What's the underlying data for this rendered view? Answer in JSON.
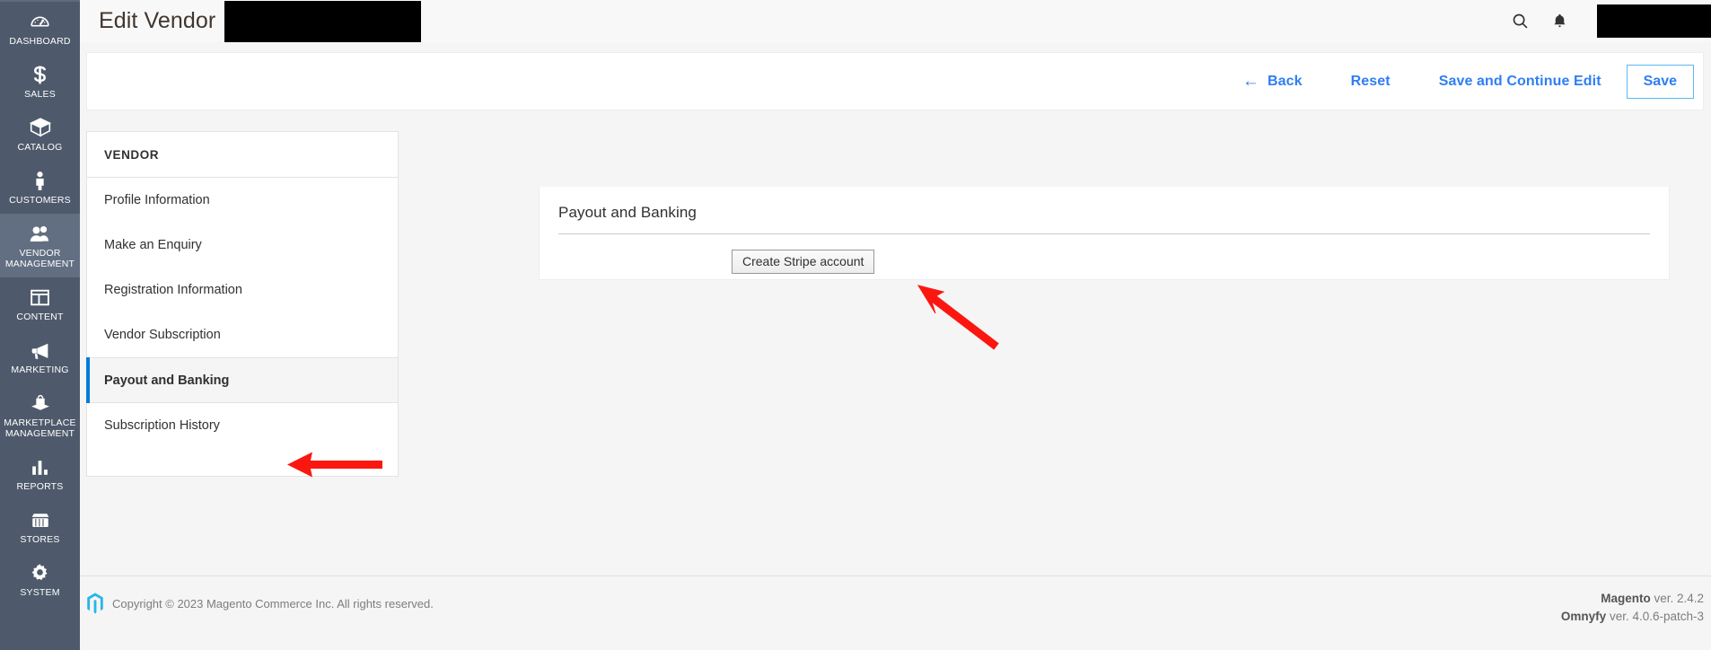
{
  "admin_rail": {
    "items": [
      {
        "label": "DASHBOARD",
        "icon": "dashboard-gauge-icon",
        "active": false
      },
      {
        "label": "SALES",
        "icon": "dollar-sign-icon",
        "active": false
      },
      {
        "label": "CATALOG",
        "icon": "box-icon",
        "active": false
      },
      {
        "label": "CUSTOMERS",
        "icon": "person-icon",
        "active": false
      },
      {
        "label": "VENDOR MANAGEMENT",
        "icon": "two-people-icon",
        "active": true
      },
      {
        "label": "CONTENT",
        "icon": "layout-panels-icon",
        "active": false
      },
      {
        "label": "MARKETING",
        "icon": "megaphone-icon",
        "active": false
      },
      {
        "label": "MARKETPLACE MANAGEMENT",
        "icon": "shopping-bag-icon",
        "active": false
      },
      {
        "label": "REPORTS",
        "icon": "bar-chart-icon",
        "active": false
      },
      {
        "label": "STORES",
        "icon": "storefront-icon",
        "active": false
      },
      {
        "label": "SYSTEM",
        "icon": "gear-icon",
        "active": false
      }
    ]
  },
  "header": {
    "title": "Edit Vendor",
    "title_redacted": true,
    "search_icon": "search-icon",
    "notifications_icon": "bell-icon",
    "user_redacted": true
  },
  "action_bar": {
    "back_label": "Back",
    "back_arrow": "←",
    "reset_label": "Reset",
    "save_continue_label": "Save and Continue Edit",
    "save_label": "Save"
  },
  "vendor_nav": {
    "heading": "VENDOR",
    "items": [
      {
        "label": "Profile Information",
        "active": false
      },
      {
        "label": "Make an Enquiry",
        "active": false
      },
      {
        "label": "Registration Information",
        "active": false
      },
      {
        "label": "Vendor Subscription",
        "active": false
      },
      {
        "label": "Payout and Banking",
        "active": true
      },
      {
        "label": "Subscription History",
        "active": false
      }
    ]
  },
  "content": {
    "section_title": "Payout and Banking",
    "create_stripe_label": "Create Stripe account"
  },
  "annotations": {
    "color": "#fb1710",
    "arrows": [
      {
        "name": "arrow-to-payout-and-banking",
        "direction": "left",
        "target": "Payout and Banking"
      },
      {
        "name": "arrow-to-create-stripe-account",
        "direction": "up-left",
        "target": "Create Stripe account"
      }
    ]
  },
  "footer": {
    "copyright": "Copyright © 2023 Magento Commerce Inc. All rights reserved.",
    "logo": "magento-logo-icon",
    "magento_name": "Magento",
    "magento_version": " ver. 2.4.2",
    "omnyfy_name": "Omnyfy",
    "omnyfy_version": " ver. 4.0.6-patch-3"
  },
  "colors": {
    "rail_bg": "#4e5a6b",
    "rail_active": "#626f82",
    "link_blue": "#2f7ef3",
    "active_bar_blue": "#007bdb",
    "annotation_red": "#fb1710",
    "page_bg": "#f5f5f5"
  }
}
